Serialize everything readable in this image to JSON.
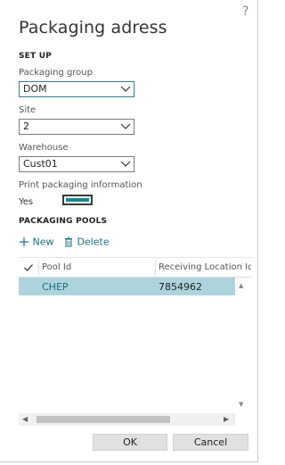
{
  "dialog": {
    "title": "Packaging adress",
    "help_label": "?"
  },
  "setup": {
    "heading": "SET UP",
    "packaging_group": {
      "label": "Packaging group",
      "value": "DOM"
    },
    "site": {
      "label": "Site",
      "value": "2"
    },
    "warehouse": {
      "label": "Warehouse",
      "value": "Cust01"
    },
    "print_packaging": {
      "label": "Print packaging information",
      "value": "Yes",
      "checked": true
    }
  },
  "pools": {
    "heading": "PACKAGING POOLS",
    "new_label": "New",
    "delete_label": "Delete",
    "columns": [
      "Pool Id",
      "Receiving Location Id"
    ],
    "rows": [
      {
        "pool_id": "CHEP",
        "receiving_location_id": "7854962"
      }
    ]
  },
  "footer": {
    "ok_label": "OK",
    "cancel_label": "Cancel"
  },
  "colors": {
    "accent": "#16888f",
    "selected_row": "#add4dd",
    "link": "#1b6e7b"
  }
}
